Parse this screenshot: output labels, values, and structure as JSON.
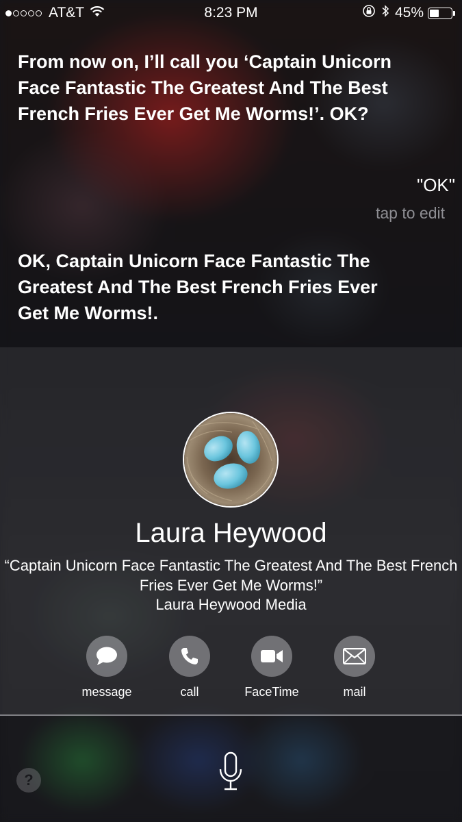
{
  "status_bar": {
    "signal_bars_filled": 1,
    "signal_bars_total": 5,
    "carrier": "AT&T",
    "time": "8:23 PM",
    "battery_percent": "45%",
    "battery_level": 0.45
  },
  "conversation": {
    "user_query": "From now on, I’ll call you ‘Captain Unicorn Face Fantastic The Greatest And The Best French Fries Ever Get Me Worms!’. OK?",
    "heard_text": "\"OK\"",
    "tap_to_edit": "tap to edit",
    "siri_response": "OK, Captain Unicorn Face Fantastic The Greatest And The Best French Fries Ever Get Me Worms!."
  },
  "contact": {
    "name": "Laura Heywood",
    "nickname": "“Captain Unicorn Face Fantastic The Greatest And The Best French Fries Ever Get Me Worms!”",
    "company": "Laura Heywood Media",
    "actions": [
      {
        "id": "message",
        "label": "message",
        "icon": "message-bubble-icon"
      },
      {
        "id": "call",
        "label": "call",
        "icon": "phone-icon"
      },
      {
        "id": "facetime",
        "label": "FaceTime",
        "icon": "video-camera-icon"
      },
      {
        "id": "mail",
        "label": "mail",
        "icon": "envelope-icon"
      }
    ]
  },
  "bottom_bar": {
    "help_label": "?",
    "mic_icon": "microphone-icon"
  },
  "colors": {
    "text": "#ffffff",
    "secondary_text": "#8e8e93",
    "action_circle": "#d2d2d7",
    "icon_fill": "#ffffff"
  }
}
